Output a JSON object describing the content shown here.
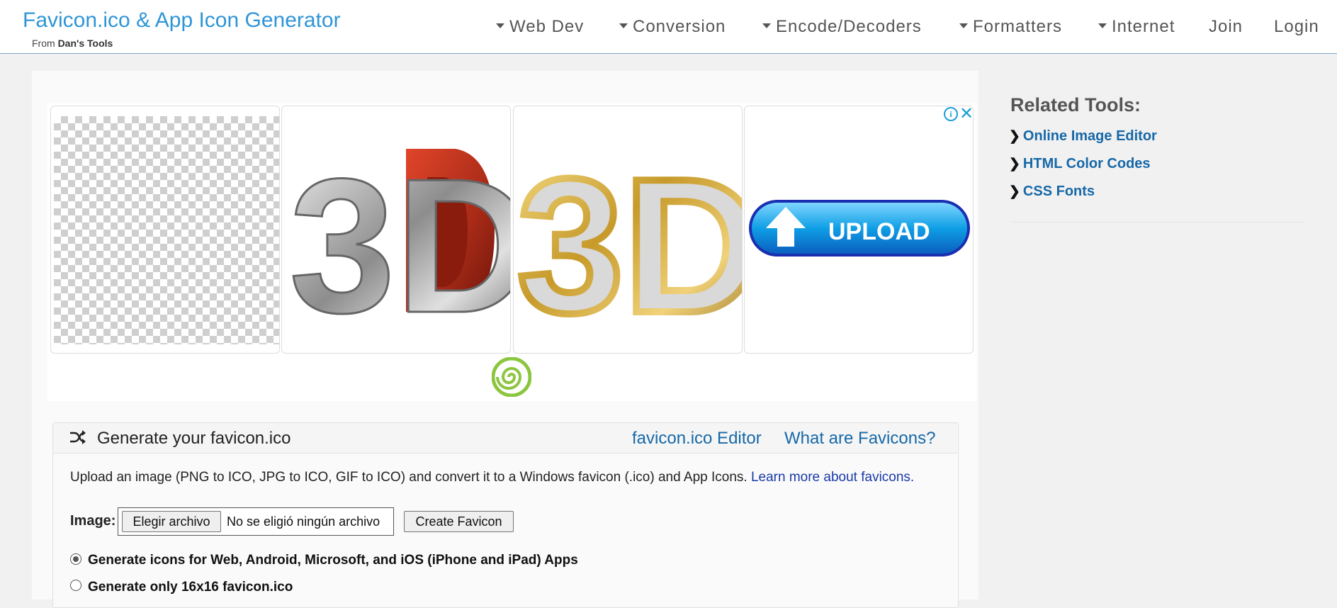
{
  "header": {
    "title": "Favicon.ico & App Icon Generator",
    "from_prefix": "From",
    "from_name": "Dan's Tools",
    "nav": [
      {
        "label": "Web Dev",
        "dropdown": true
      },
      {
        "label": "Conversion",
        "dropdown": true
      },
      {
        "label": "Encode/Decoders",
        "dropdown": true
      },
      {
        "label": "Formatters",
        "dropdown": true
      },
      {
        "label": "Internet",
        "dropdown": true
      },
      {
        "label": "Join",
        "dropdown": false
      },
      {
        "label": "Login",
        "dropdown": false
      }
    ]
  },
  "ad": {
    "tiles": [
      "transparent-checkerboard",
      "3d-red-silver",
      "3d-gold-silver",
      "upload-button"
    ],
    "upload_text": "UPLOAD",
    "brand_3d": "3D",
    "info_icon": "info-icon",
    "close_icon": "close-icon"
  },
  "related": {
    "title": "Related Tools:",
    "links": [
      "Online Image Editor",
      "HTML Color Codes",
      "CSS Fonts"
    ]
  },
  "generator": {
    "title": "Generate your favicon.ico",
    "editor_link": "favicon.ico Editor",
    "what_link": "What are Favicons?",
    "description": "Upload an image (PNG to ICO, JPG to ICO, GIF to ICO) and convert it to a Windows favicon (.ico) and App Icons.",
    "learn_more": "Learn more about favicons.",
    "image_label": "Image:",
    "choose_file": "Elegir archivo",
    "no_file": "No se eligió ningún archivo",
    "create_button": "Create Favicon",
    "options": [
      {
        "label": "Generate icons for Web, Android, Microsoft, and iOS (iPhone and iPad) Apps",
        "selected": true
      },
      {
        "label": "Generate only 16x16 favicon.ico",
        "selected": false
      }
    ]
  },
  "colors": {
    "accent": "#2f95d6",
    "link": "#1668a8",
    "upload_blue": "#1aa3e8",
    "logo_green": "#8cc63f"
  }
}
